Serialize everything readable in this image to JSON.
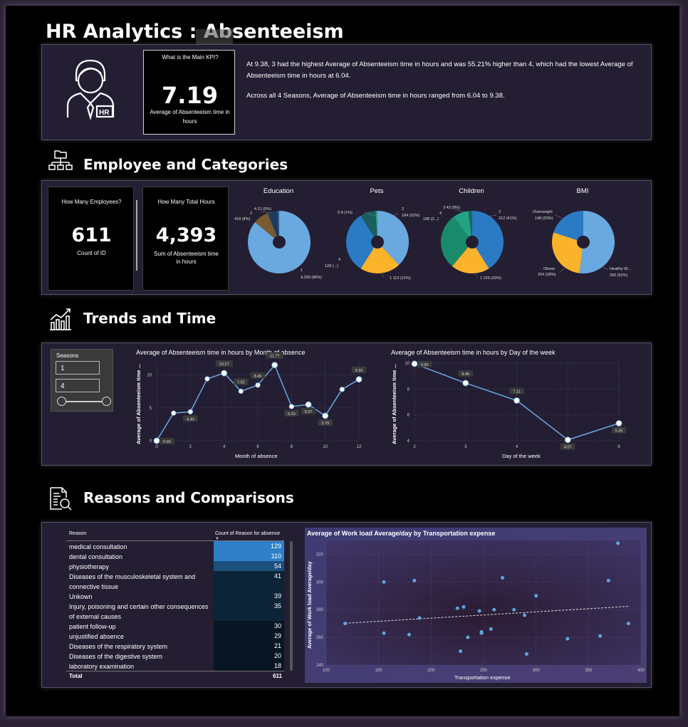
{
  "title": "HR Analytics : Absenteeism",
  "kpi": {
    "question": "What is the Main KPI?",
    "value": "7.19",
    "caption": "Average of Absenteeism time in hours"
  },
  "narrative": {
    "line1": "At 9.38, 3 had the highest Average of Absenteeism time in hours and was 55.21% higher than 4, which had the lowest Average of Absenteeism time in hours at 6.04.",
    "line2": "Across all 4 Seasons, Average of Absenteeism time in hours ranged from 6.04 to 9.38."
  },
  "sections": {
    "employees": "Employee and Categories",
    "trends": "Trends and Time",
    "reasons": "Reasons and Comparisons"
  },
  "cards": {
    "employees_q": "How Many Employees?",
    "employees_val": "611",
    "employees_cap": "Count of ID",
    "hours_q": "How Many Total Hours",
    "hours_val": "4,393",
    "hours_cap": "Sum of Absenteeism time in hours"
  },
  "donuts": {
    "education": {
      "title": "Education",
      "labels": [
        "4 21 (0%)",
        "2",
        "418 (8%)",
        "1",
        "4,299 (86%)"
      ]
    },
    "pets": {
      "title": "Pets",
      "labels": [
        "5 8 (1%)",
        "2",
        "184 (32%)",
        "4",
        "128 (...)",
        "1 113 (21%)"
      ]
    },
    "children": {
      "title": "Children",
      "labels": [
        "3 43 (8%)",
        "4",
        "188 (2...)",
        "2",
        "212 (41%)",
        "1 229 (20%)"
      ]
    },
    "bmi": {
      "title": "BMI",
      "labels": [
        "Overweight",
        "148 (20%)",
        "Obese",
        "204 (28%)",
        "Healthy W...",
        "290 (52%)"
      ]
    }
  },
  "slicer": {
    "title": "Seasons",
    "from": "1",
    "to": "4"
  },
  "chart_data": [
    {
      "type": "pie",
      "title": "Education",
      "categories": [
        "1",
        "2",
        "3",
        "4"
      ],
      "values": [
        86,
        8,
        5,
        1
      ],
      "colors": [
        "#6aa9e0",
        "#7a5a30",
        "#1f3a5f",
        "#2f5d8a"
      ]
    },
    {
      "type": "pie",
      "title": "Pets",
      "categories": [
        "0",
        "1",
        "2",
        "4",
        "5"
      ],
      "values": [
        38,
        21,
        32,
        8,
        1
      ],
      "colors": [
        "#6aa9e0",
        "#fbb32c",
        "#2a7bc4",
        "#1b5e5e",
        "#22a386"
      ]
    },
    {
      "type": "pie",
      "title": "Children",
      "categories": [
        "2",
        "1",
        "0",
        "3",
        "4"
      ],
      "values": [
        41,
        20,
        29,
        8,
        2
      ],
      "colors": [
        "#2a7bc4",
        "#fbb32c",
        "#1b8a6b",
        "#22a386",
        "#186a5c"
      ]
    },
    {
      "type": "pie",
      "title": "BMI",
      "categories": [
        "Healthy W...",
        "Obese",
        "Overweight"
      ],
      "values": [
        52,
        28,
        20
      ],
      "colors": [
        "#6aa9e0",
        "#fbb32c",
        "#2a7bc4"
      ]
    },
    {
      "type": "line",
      "title": "Average of Absenteeism time in hours by Month of absence",
      "xlabel": "Month of absence",
      "ylabel": "Average of Absenteeism time ...",
      "x": [
        0,
        1,
        2,
        3,
        4,
        5,
        6,
        7,
        8,
        9,
        10,
        11,
        12
      ],
      "values": [
        0,
        4.2,
        4.4,
        9.4,
        10.27,
        7.52,
        8.45,
        11.5,
        5.2,
        5.5,
        3.79,
        7.8,
        9.32
      ],
      "point_labels": [
        "0.00",
        "",
        "4.40",
        "",
        "10.27",
        "7.52",
        "8.45",
        "11.??",
        "5.20",
        "5.5?",
        "3.79",
        "",
        "9.32"
      ],
      "xticks": [
        "0",
        "2",
        "4",
        "6",
        "8",
        "10",
        "12"
      ],
      "yticks": [
        "0",
        "5",
        "10"
      ],
      "ylim": [
        0,
        12
      ]
    },
    {
      "type": "line",
      "title": "Average of Absenteeism time in hours by Day of the week",
      "xlabel": "Day of the week",
      "ylabel": "Average of Absenteeism time ...",
      "x": [
        2,
        3,
        4,
        5,
        6
      ],
      "values": [
        9.95,
        8.46,
        7.11,
        4.07,
        5.35
      ],
      "point_labels": [
        "9.95",
        "8.46",
        "7.11",
        "4.07",
        "5.35"
      ],
      "xticks": [
        "2",
        "3",
        "4",
        "5",
        "6"
      ],
      "yticks": [
        "4",
        "6",
        "8",
        "10"
      ],
      "ylim": [
        4,
        10
      ]
    },
    {
      "type": "scatter",
      "title": "Average of Work load Average/day by Transportation expense",
      "xlabel": "Transportation expense",
      "ylabel": "Average of Work load Average/day",
      "x": [
        118,
        155,
        155,
        179,
        184,
        189,
        225,
        228,
        231,
        235,
        246,
        248,
        248,
        257,
        260,
        268,
        279,
        289,
        291,
        300,
        330,
        361,
        369,
        378,
        388
      ],
      "values": [
        270,
        300,
        263,
        262,
        301,
        274,
        281,
        250,
        282,
        260,
        279,
        263,
        264,
        266,
        280,
        303,
        280,
        276,
        248,
        290,
        259,
        261,
        301,
        328,
        270
      ],
      "xticks": [
        "100",
        "150",
        "200",
        "250",
        "300",
        "350",
        "400"
      ],
      "yticks": [
        "240",
        "260",
        "280",
        "300",
        "320"
      ],
      "xlim": [
        100,
        400
      ],
      "ylim": [
        240,
        330
      ]
    },
    {
      "type": "table",
      "title": "Count of Reason for absence",
      "columns": [
        "Reason",
        "Count of Reason for absence"
      ],
      "rows": [
        [
          "medical consultation",
          129
        ],
        [
          "dental consultation",
          110
        ],
        [
          "physiotherapy",
          54
        ],
        [
          "Diseases of the musculoskeletal system and connective tissue",
          41
        ],
        [
          "Unkown",
          39
        ],
        [
          "Injury, poisoning and certain other consequences of external causes",
          35
        ],
        [
          "patient follow-up",
          30
        ],
        [
          "unjustified absence",
          29
        ],
        [
          "Diseases of the respiratory system",
          21
        ],
        [
          "Diseases of the digestive system",
          20
        ],
        [
          "laboratory examination",
          18
        ]
      ],
      "total_label": "Total",
      "total": 611
    }
  ]
}
